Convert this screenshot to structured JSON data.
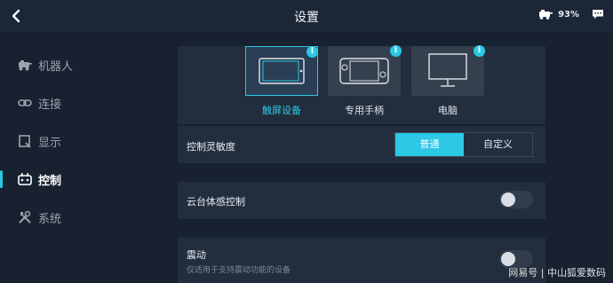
{
  "header": {
    "title": "设置",
    "battery": "93%"
  },
  "sidebar": {
    "items": [
      {
        "label": "机器人"
      },
      {
        "label": "连接"
      },
      {
        "label": "显示"
      },
      {
        "label": "控制"
      },
      {
        "label": "系统"
      }
    ]
  },
  "devices": {
    "items": [
      {
        "label": "触屏设备",
        "selected": true
      },
      {
        "label": "专用手柄",
        "selected": false
      },
      {
        "label": "电脑",
        "selected": false
      }
    ],
    "info_glyph": "i"
  },
  "sensitivity": {
    "label": "控制灵敏度",
    "options": [
      "普通",
      "自定义"
    ],
    "selected": "普通"
  },
  "gimbal_motion": {
    "label": "云台体感控制",
    "enabled": false
  },
  "vibration": {
    "label": "震动",
    "note": "仅适用于支持震动功能的设备",
    "enabled": false
  },
  "watermark": "网易号 | 中山狐爱数码",
  "colors": {
    "accent": "#2cc8e6",
    "background": "#172130",
    "panel": "#222e3d"
  }
}
